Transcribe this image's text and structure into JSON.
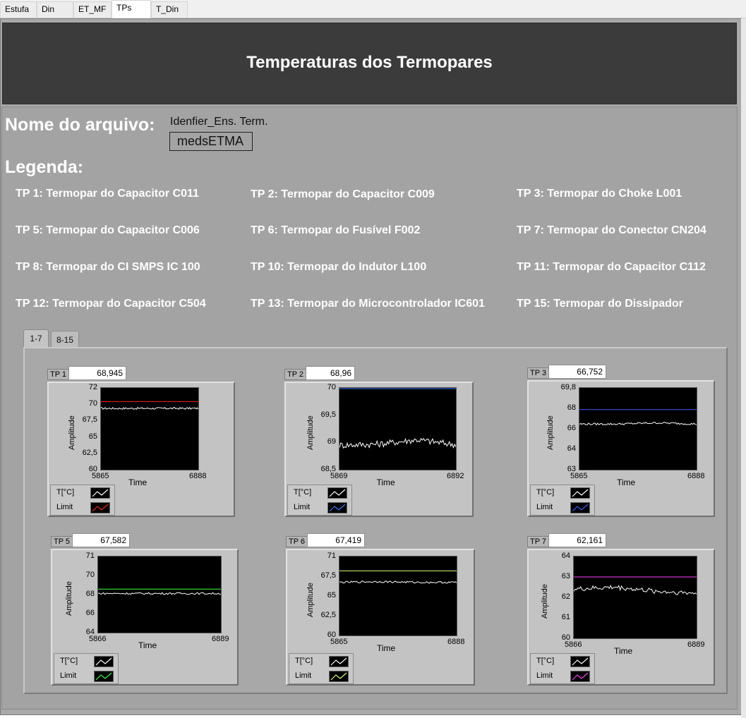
{
  "tabs": [
    {
      "label": "Estufa"
    },
    {
      "label": "Din"
    },
    {
      "label": "ET_MF"
    },
    {
      "label": "TPs"
    },
    {
      "label": "T_Din"
    }
  ],
  "header": {
    "title": "Temperaturas dos Termopares"
  },
  "file": {
    "heading": "Nome do arquivo:",
    "label": "Idenfier_Ens. Term.",
    "value": "medsETMA"
  },
  "legend": {
    "heading": "Legenda:",
    "items": [
      "TP 1: Termopar do Capacitor C011",
      "TP 2: Termopar do Capacitor C009",
      "TP 3: Termopar do Choke L001",
      "TP 5: Termopar do Capacitor C006",
      "TP 6: Termopar do Fusível F002",
      "TP 7: Termopar do Conector CN204",
      "TP 8: Termopar do CI SMPS IC 100",
      "TP 10: Termopar do Indutor L100",
      "TP 11: Termopar do Capacitor C112",
      "TP 12: Termopar do Capacitor C504",
      "TP 13: Termopar do Microcontrolador IC601",
      "TP 15: Termopar do Dissipador"
    ]
  },
  "graph_tabs": [
    {
      "label": "1-7"
    },
    {
      "label": "8-15"
    }
  ],
  "graph_common": {
    "ylabel": "Amplitude",
    "xlabel": "Time",
    "legend_temp": "T[°C]",
    "legend_limit": "Limit"
  },
  "graphs": [
    {
      "tag": "TP 1",
      "value": "68,945",
      "yticks": [
        "72",
        "70",
        "67,5",
        "65",
        "62,5",
        "60"
      ],
      "xmin": "5865",
      "xmax": "6888",
      "limit_color": "#ff2020"
    },
    {
      "tag": "TP 2",
      "value": "68,96",
      "yticks": [
        "70",
        "69,5",
        "69",
        "68,5"
      ],
      "xmin": "5869",
      "xmax": "6892",
      "limit_color": "#3a7dff"
    },
    {
      "tag": "TP 3",
      "value": "66,752",
      "yticks": [
        "69,8",
        "68",
        "66",
        "64",
        "63"
      ],
      "xmin": "5865",
      "xmax": "6888",
      "limit_color": "#3a5cff"
    },
    {
      "tag": "TP 5",
      "value": "67,582",
      "yticks": [
        "71",
        "70",
        "68",
        "66",
        "64"
      ],
      "xmin": "5866",
      "xmax": "6889",
      "limit_color": "#40ff40"
    },
    {
      "tag": "TP 6",
      "value": "67,419",
      "yticks": [
        "71",
        "67,5",
        "65",
        "62,5",
        "60"
      ],
      "xmin": "5865",
      "xmax": "6888",
      "limit_color": "#d8ff70"
    },
    {
      "tag": "TP 7",
      "value": "62,161",
      "yticks": [
        "64",
        "63",
        "62",
        "61",
        "60"
      ],
      "xmin": "5866",
      "xmax": "6889",
      "limit_color": "#ff40ff"
    }
  ],
  "chart_data": [
    {
      "type": "line",
      "series": [
        {
          "name": "T[°C]",
          "values": [
            69,
            69,
            69,
            69
          ]
        },
        {
          "name": "Limit",
          "values": [
            70,
            70,
            70,
            70
          ]
        }
      ],
      "xlabel": "Time",
      "ylabel": "Amplitude",
      "xlim": [
        5865,
        6888
      ],
      "ylim": [
        60,
        72
      ]
    },
    {
      "type": "line",
      "series": [
        {
          "name": "T[°C]",
          "values": [
            68.95,
            68.97,
            69.05,
            68.96
          ]
        },
        {
          "name": "Limit",
          "values": [
            70,
            70,
            70,
            70
          ]
        }
      ],
      "xlabel": "Time",
      "ylabel": "Amplitude",
      "xlim": [
        5869,
        6892
      ],
      "ylim": [
        68.5,
        70
      ]
    },
    {
      "type": "line",
      "series": [
        {
          "name": "T[°C]",
          "values": [
            66.8,
            66.8,
            66.9,
            66.8
          ]
        },
        {
          "name": "Limit",
          "values": [
            68,
            68,
            68,
            68
          ]
        }
      ],
      "xlabel": "Time",
      "ylabel": "Amplitude",
      "xlim": [
        5865,
        6888
      ],
      "ylim": [
        63,
        69.8
      ]
    },
    {
      "type": "line",
      "series": [
        {
          "name": "T[°C]",
          "values": [
            67.6,
            67.6,
            67.6,
            67.6
          ]
        },
        {
          "name": "Limit",
          "values": [
            68,
            68,
            68,
            68
          ]
        }
      ],
      "xlabel": "Time",
      "ylabel": "Amplitude",
      "xlim": [
        5866,
        6889
      ],
      "ylim": [
        64,
        71
      ]
    },
    {
      "type": "line",
      "series": [
        {
          "name": "T[°C]",
          "values": [
            67.4,
            67.5,
            67.4,
            67.4
          ]
        },
        {
          "name": "Limit",
          "values": [
            69,
            69,
            69,
            69
          ]
        }
      ],
      "xlabel": "Time",
      "ylabel": "Amplitude",
      "xlim": [
        5865,
        6888
      ],
      "ylim": [
        60,
        71
      ]
    },
    {
      "type": "line",
      "series": [
        {
          "name": "T[°C]",
          "values": [
            62.4,
            62.5,
            62.3,
            62.2
          ]
        },
        {
          "name": "Limit",
          "values": [
            63,
            63,
            63,
            63
          ]
        }
      ],
      "xlabel": "Time",
      "ylabel": "Amplitude",
      "xlim": [
        5866,
        6889
      ],
      "ylim": [
        60,
        64
      ]
    }
  ]
}
